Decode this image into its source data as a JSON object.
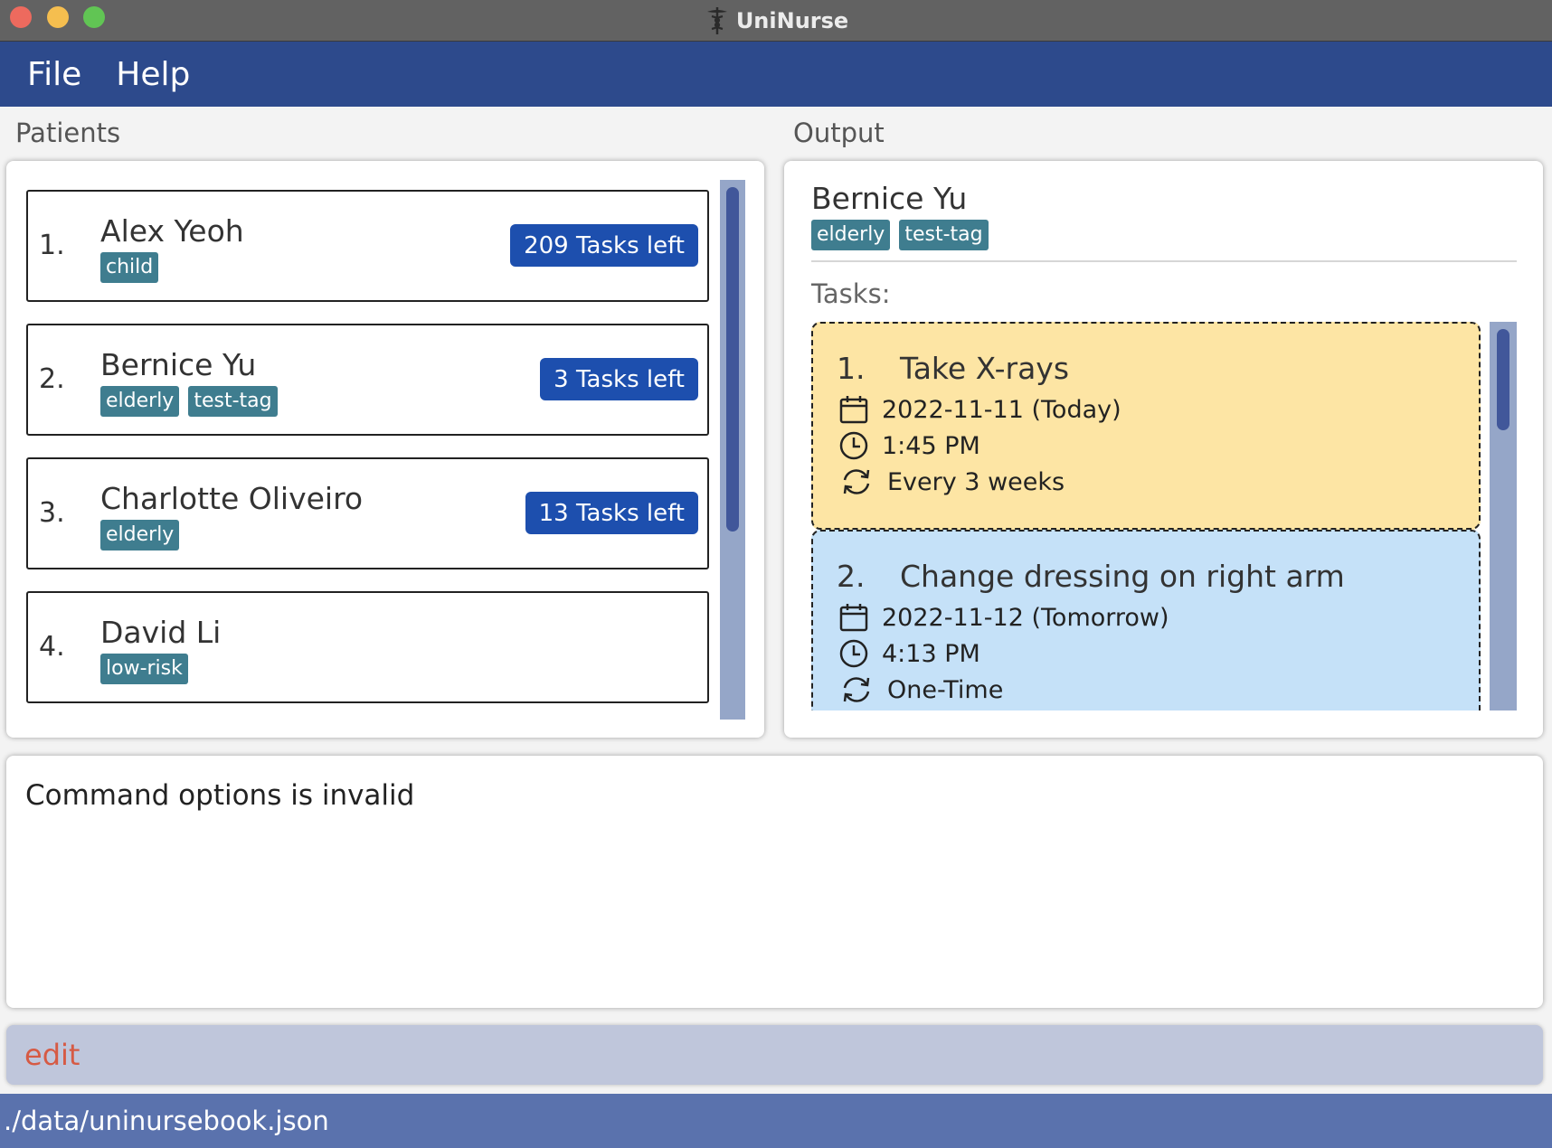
{
  "window": {
    "title": "UniNurse"
  },
  "menu": {
    "file": "File",
    "help": "Help"
  },
  "sections": {
    "patients": "Patients",
    "output": "Output"
  },
  "patients": [
    {
      "index": "1.",
      "name": "Alex Yeoh",
      "tags": [
        "child"
      ],
      "tasks_left": "209 Tasks left"
    },
    {
      "index": "2.",
      "name": "Bernice Yu",
      "tags": [
        "elderly",
        "test-tag"
      ],
      "tasks_left": "3 Tasks left"
    },
    {
      "index": "3.",
      "name": "Charlotte Oliveiro",
      "tags": [
        "elderly"
      ],
      "tasks_left": "13 Tasks left"
    },
    {
      "index": "4.",
      "name": "David Li",
      "tags": [
        "low-risk"
      ],
      "tasks_left": ""
    }
  ],
  "output": {
    "name": "Bernice Yu",
    "tags": [
      "elderly",
      "test-tag"
    ],
    "tasks_label": "Tasks:",
    "tasks": [
      {
        "index": "1.",
        "title": "Take X-rays",
        "date": "2022-11-11 (Today)",
        "time": "1:45 PM",
        "recurrence": "Every 3 weeks",
        "color": "#fde5a4"
      },
      {
        "index": "2.",
        "title": "Change dressing on right arm",
        "date": "2022-11-12 (Tomorrow)",
        "time": "4:13 PM",
        "recurrence": "One-Time",
        "color": "#c5e1f8"
      }
    ]
  },
  "result": {
    "message": "Command options is invalid"
  },
  "command": {
    "value": "edit"
  },
  "status": {
    "path": "./data/uninursebook.json"
  },
  "colors": {
    "menubar": "#2d4a8c",
    "badge": "#1d4fae",
    "tag": "#3f7d8f",
    "statusbar": "#5a72ad",
    "command_text": "#d65a44"
  }
}
